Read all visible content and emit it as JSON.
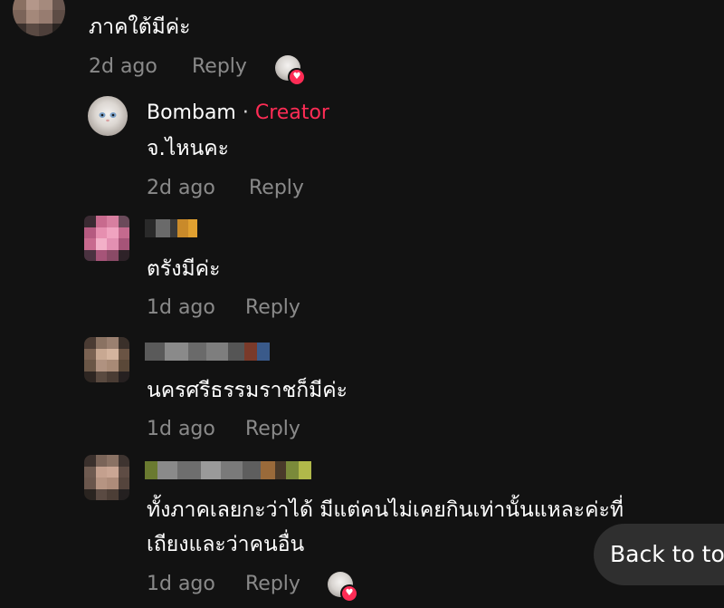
{
  "comments": [
    {
      "text": "ภาคใต้มีค่ะ",
      "time": "2d ago",
      "reply": "Reply",
      "liked_by_creator": true
    },
    {
      "name": "Bombam",
      "separator": "·",
      "badge": "Creator",
      "text": "จ.ไหนคะ",
      "time": "2d ago",
      "reply": "Reply"
    },
    {
      "text": "ตรังมีค่ะ",
      "time": "1d ago",
      "reply": "Reply"
    },
    {
      "text": "นครศรีธรรมราชก็มีค่ะ",
      "time": "1d ago",
      "reply": "Reply"
    },
    {
      "text_line1": "ทั้งภาคเลยกะว่าได้ มีแต่คนไม่เคยกินเท่านั้นแหละค่ะที่",
      "text_line2": "เถียงและว่าคนอื่น",
      "time": "1d ago",
      "reply": "Reply",
      "liked_by_creator": true
    }
  ],
  "back_to_top": "Back to top",
  "colors": {
    "background": "#121212",
    "creator_badge": "#fe2c55",
    "meta_text": "rgba(255,255,255,0.5)"
  }
}
